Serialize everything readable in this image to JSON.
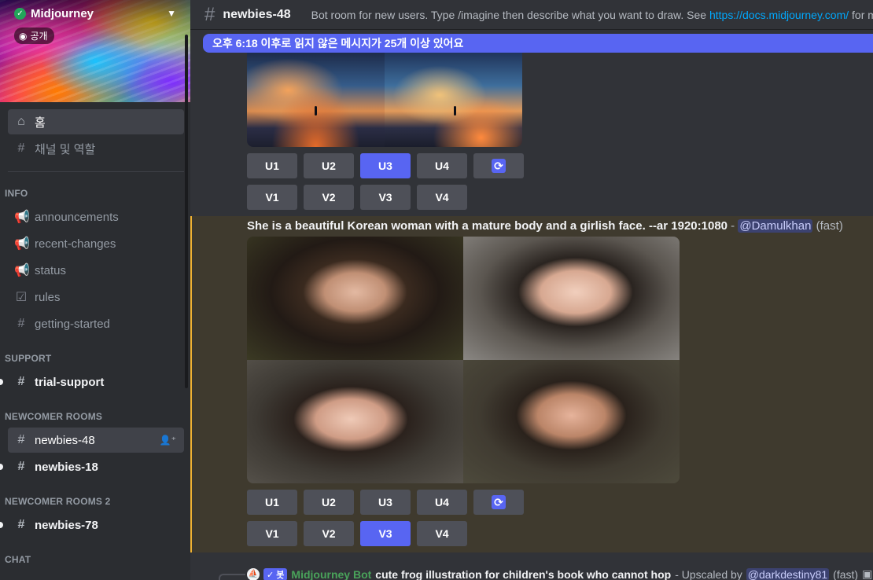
{
  "sidebar": {
    "server_name": "Midjourney",
    "verified_icon": "check-circle-icon",
    "public_label": "공개",
    "top_items": [
      {
        "label": "홈",
        "icon": "home-icon"
      },
      {
        "label": "채널 및 역할",
        "icon": "channel-browse-icon"
      }
    ],
    "categories": [
      {
        "name": "INFO",
        "channels": [
          {
            "label": "announcements",
            "icon": "megaphone-icon"
          },
          {
            "label": "recent-changes",
            "icon": "megaphone-icon"
          },
          {
            "label": "status",
            "icon": "megaphone-icon"
          },
          {
            "label": "rules",
            "icon": "checkbox-icon"
          },
          {
            "label": "getting-started",
            "icon": "hash-icon"
          }
        ]
      },
      {
        "name": "SUPPORT",
        "channels": [
          {
            "label": "trial-support",
            "icon": "hash-icon"
          }
        ]
      },
      {
        "name": "NEWCOMER ROOMS",
        "channels": [
          {
            "label": "newbies-48",
            "icon": "hash-thread-icon"
          },
          {
            "label": "newbies-18",
            "icon": "hash-thread-icon"
          }
        ]
      },
      {
        "name": "NEWCOMER ROOMS 2",
        "channels": [
          {
            "label": "newbies-78",
            "icon": "hash-thread-icon"
          }
        ]
      },
      {
        "name": "CHAT",
        "channels": []
      }
    ]
  },
  "header": {
    "channel": "newbies-48",
    "topic_prefix": "Bot room for new users. Type /imagine then describe what you want to draw. See ",
    "topic_link": "https://docs.midjourney.com/",
    "topic_suffix": " for more"
  },
  "new_messages_bar": "오후 6:18 이후로 읽지 않은 메시지가 25개 이상 있어요",
  "messages": [
    {
      "upscale_buttons": [
        "U1",
        "U2",
        "U3",
        "U4"
      ],
      "variation_buttons": [
        "V1",
        "V2",
        "V3",
        "V4"
      ],
      "active_button": "U3"
    },
    {
      "prompt": "She is a beautiful Korean woman with a mature body and a girlish face. --ar 1920:1080",
      "separator": " - ",
      "mention": "@Damulkhan",
      "speed": "(fast)",
      "upscale_buttons": [
        "U1",
        "U2",
        "U3",
        "U4"
      ],
      "variation_buttons": [
        "V1",
        "V2",
        "V3",
        "V4"
      ],
      "active_button": "V3"
    },
    {
      "bot_name": "Midjourney Bot",
      "bot_tag": "✓ 봇",
      "prompt": "cute frog illustration for children's book who cannot hop",
      "action": " - Upscaled by ",
      "mention": "@darkdestiny81",
      "speed": "(fast)"
    }
  ],
  "colors": {
    "accent": "#5865f2",
    "mention_highlight": "#f0b232",
    "bot_green": "#49a35a"
  }
}
